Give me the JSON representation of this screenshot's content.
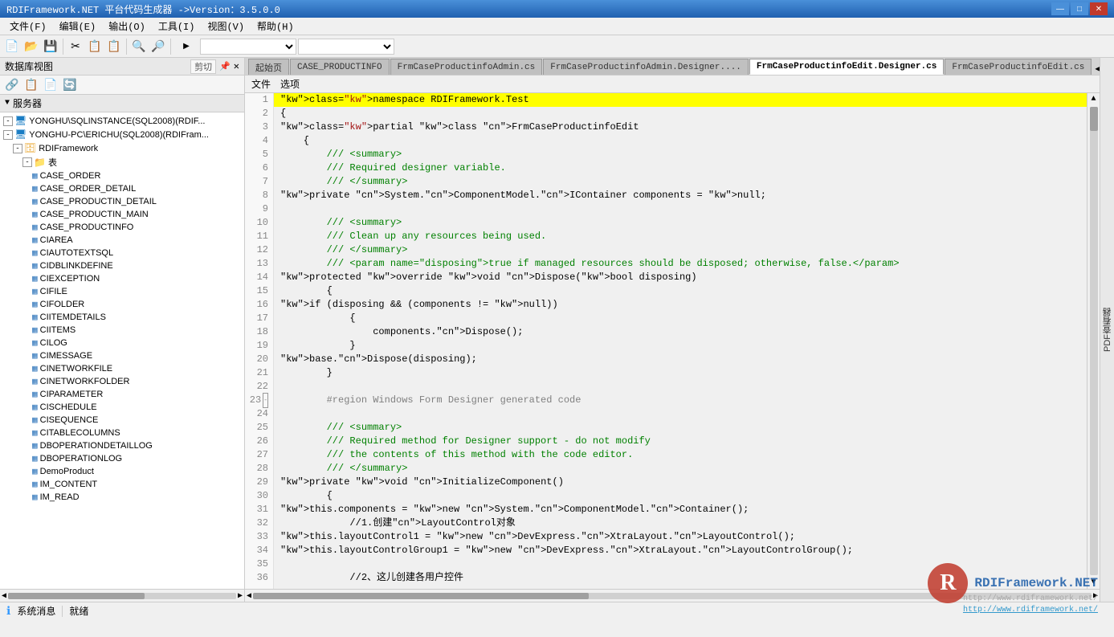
{
  "titleBar": {
    "title": "RDIFramework.NET 平台代码生成器 ->Version：3.5.0.0",
    "minimize": "—",
    "maximize": "□",
    "close": "✕"
  },
  "menuBar": {
    "items": [
      {
        "label": "文件(F)",
        "id": "menu-file"
      },
      {
        "label": "编辑(E)",
        "id": "menu-edit"
      },
      {
        "label": "输出(O)",
        "id": "menu-output"
      },
      {
        "label": "工具(I)",
        "id": "menu-tools"
      },
      {
        "label": "视图(V)",
        "id": "menu-view"
      },
      {
        "label": "帮助(H)",
        "id": "menu-help"
      }
    ]
  },
  "leftPanel": {
    "header": "数据库视图",
    "pinLabel": "剪切",
    "closeBtn": "✕",
    "toolbar": [
      "🔗",
      "📋",
      "📄",
      "🔄"
    ],
    "serverLabel": "服务器",
    "tree": [
      {
        "id": "server1",
        "label": "YONGHU\\SQLINSTANCE(SQL2008)(RDIF...",
        "indent": 0,
        "expand": "-",
        "icon": "🖥"
      },
      {
        "id": "server2",
        "label": "YONGHU-PC\\ERICHU(SQL2008)(RDIFram...",
        "indent": 0,
        "expand": "-",
        "icon": "🖥"
      },
      {
        "id": "db1",
        "label": "RDIFramework",
        "indent": 1,
        "expand": "-",
        "icon": "🗄"
      },
      {
        "id": "tables",
        "label": "表",
        "indent": 2,
        "expand": "-",
        "icon": "📁"
      },
      {
        "id": "t1",
        "label": "CASE_ORDER",
        "indent": 3,
        "icon": "📋"
      },
      {
        "id": "t2",
        "label": "CASE_ORDER_DETAIL",
        "indent": 3,
        "icon": "📋"
      },
      {
        "id": "t3",
        "label": "CASE_PRODUCTIN_DETAIL",
        "indent": 3,
        "icon": "📋"
      },
      {
        "id": "t4",
        "label": "CASE_PRODUCTIN_MAIN",
        "indent": 3,
        "icon": "📋"
      },
      {
        "id": "t5",
        "label": "CASE_PRODUCTINFO",
        "indent": 3,
        "icon": "📋"
      },
      {
        "id": "t6",
        "label": "CIAREA",
        "indent": 3,
        "icon": "📋"
      },
      {
        "id": "t7",
        "label": "CIAUTOTEXTSQL",
        "indent": 3,
        "icon": "📋"
      },
      {
        "id": "t8",
        "label": "CIDBLINKDEFINE",
        "indent": 3,
        "icon": "📋"
      },
      {
        "id": "t9",
        "label": "CIEXCEPTION",
        "indent": 3,
        "icon": "📋"
      },
      {
        "id": "t10",
        "label": "CIFILE",
        "indent": 3,
        "icon": "📋"
      },
      {
        "id": "t11",
        "label": "CIFOLDER",
        "indent": 3,
        "icon": "📋"
      },
      {
        "id": "t12",
        "label": "CIITEMDETAILS",
        "indent": 3,
        "icon": "📋"
      },
      {
        "id": "t13",
        "label": "CIITEMS",
        "indent": 3,
        "icon": "📋"
      },
      {
        "id": "t14",
        "label": "CILOG",
        "indent": 3,
        "icon": "📋"
      },
      {
        "id": "t15",
        "label": "CIMESSAGE",
        "indent": 3,
        "icon": "📋"
      },
      {
        "id": "t16",
        "label": "CINETWORKFILE",
        "indent": 3,
        "icon": "📋"
      },
      {
        "id": "t17",
        "label": "CINETWORKFOLDER",
        "indent": 3,
        "icon": "📋"
      },
      {
        "id": "t18",
        "label": "CIPARAMETER",
        "indent": 3,
        "icon": "📋"
      },
      {
        "id": "t19",
        "label": "CISCHEDULE",
        "indent": 3,
        "icon": "📋"
      },
      {
        "id": "t20",
        "label": "CISEQUENCE",
        "indent": 3,
        "icon": "📋"
      },
      {
        "id": "t21",
        "label": "CITABLECOLUMNS",
        "indent": 3,
        "icon": "📋"
      },
      {
        "id": "t22",
        "label": "DBOPERATIONDETAILLOG",
        "indent": 3,
        "icon": "📋"
      },
      {
        "id": "t23",
        "label": "DBOPERATIONLOG",
        "indent": 3,
        "icon": "📋"
      },
      {
        "id": "t24",
        "label": "DemoProduct",
        "indent": 3,
        "icon": "📋"
      },
      {
        "id": "t25",
        "label": "IM_CONTENT",
        "indent": 3,
        "icon": "📋"
      },
      {
        "id": "t26",
        "label": "IM_READ",
        "indent": 3,
        "icon": "📋"
      }
    ]
  },
  "tabs": {
    "items": [
      {
        "label": "起始页",
        "active": false
      },
      {
        "label": "CASE_PRODUCTINFO",
        "active": false
      },
      {
        "label": "FrmCaseProductinfoAdmin.cs",
        "active": false
      },
      {
        "label": "FrmCaseProductinfoAdmin.Designer....",
        "active": false
      },
      {
        "label": "FrmCaseProductinfoEdit.Designer.cs",
        "active": true
      },
      {
        "label": "FrmCaseProductinfoEdit.cs",
        "active": false
      }
    ],
    "fileMenu": "文件",
    "choiceMenu": "选项"
  },
  "codeLines": [
    {
      "num": 1,
      "content": "namespace RDIFramework.Test",
      "highlight": true
    },
    {
      "num": 2,
      "content": "{"
    },
    {
      "num": 3,
      "content": "    partial class FrmCaseProductinfoEdit"
    },
    {
      "num": 4,
      "content": "    {"
    },
    {
      "num": 5,
      "content": "        /// <summary>"
    },
    {
      "num": 6,
      "content": "        /// Required designer variable."
    },
    {
      "num": 7,
      "content": "        /// </summary>"
    },
    {
      "num": 8,
      "content": "        private System.ComponentModel.IContainer components = null;"
    },
    {
      "num": 9,
      "content": ""
    },
    {
      "num": 10,
      "content": "        /// <summary>"
    },
    {
      "num": 11,
      "content": "        /// Clean up any resources being used."
    },
    {
      "num": 12,
      "content": "        /// </summary>"
    },
    {
      "num": 13,
      "content": "        /// <param name=\"disposing\">true if managed resources should be disposed; otherwise, false.</param>"
    },
    {
      "num": 14,
      "content": "        protected override void Dispose(bool disposing)"
    },
    {
      "num": 15,
      "content": "        {"
    },
    {
      "num": 16,
      "content": "            if (disposing && (components != null))"
    },
    {
      "num": 17,
      "content": "            {"
    },
    {
      "num": 18,
      "content": "                components.Dispose();"
    },
    {
      "num": 19,
      "content": "            }"
    },
    {
      "num": 20,
      "content": "            base.Dispose(disposing);"
    },
    {
      "num": 21,
      "content": "        }"
    },
    {
      "num": 22,
      "content": ""
    },
    {
      "num": 23,
      "content": "        #region Windows Form Designer generated code",
      "collapse": true
    },
    {
      "num": 24,
      "content": ""
    },
    {
      "num": 25,
      "content": "        /// <summary>"
    },
    {
      "num": 26,
      "content": "        /// Required method for Designer support - do not modify"
    },
    {
      "num": 27,
      "content": "        /// the contents of this method with the code editor."
    },
    {
      "num": 28,
      "content": "        /// </summary>"
    },
    {
      "num": 29,
      "content": "        private void InitializeComponent()"
    },
    {
      "num": 30,
      "content": "        {"
    },
    {
      "num": 31,
      "content": "            this.components = new System.ComponentModel.Container();"
    },
    {
      "num": 32,
      "content": "            //1.创建LayoutControl对象"
    },
    {
      "num": 33,
      "content": "            this.layoutControl1 = new DevExpress.XtraLayout.LayoutControl();"
    },
    {
      "num": 34,
      "content": "            this.layoutControlGroup1 = new DevExpress.XtraLayout.LayoutControlGroup();"
    },
    {
      "num": 35,
      "content": ""
    },
    {
      "num": 36,
      "content": "            //2、这儿创建各用户控件"
    }
  ],
  "statusBar": {
    "message": "系统消息",
    "status": "就绪"
  },
  "rightPanel": {
    "label": "PDF查看器"
  },
  "watermark": {
    "logoText": "R",
    "brandText": "RDIFramework.NET",
    "url1": "http://www.rdiframework.net/",
    "url2": "http://www.rdiframework.net/"
  }
}
